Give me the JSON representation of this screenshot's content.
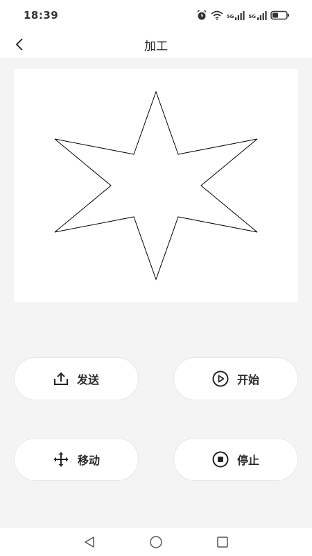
{
  "status_bar": {
    "time": "18:39",
    "network_1": "5G",
    "network_2": "5G",
    "icons": [
      "alarm-icon",
      "wifi-icon",
      "signal-icon",
      "signal-icon",
      "battery-icon"
    ]
  },
  "app_bar": {
    "title": "加工",
    "back_icon": "chevron-left-icon"
  },
  "canvas": {
    "shape": "six-pointed-star",
    "stroke_color": "#000000",
    "background": "#ffffff"
  },
  "actions": {
    "send": {
      "label": "发送",
      "icon": "upload-icon"
    },
    "start": {
      "label": "开始",
      "icon": "play-circle-icon"
    },
    "move": {
      "label": "移动",
      "icon": "move-arrows-icon"
    },
    "stop": {
      "label": "停止",
      "icon": "stop-circle-icon"
    }
  },
  "nav_bar": {
    "icons": [
      "back-triangle-icon",
      "home-circle-icon",
      "recents-square-icon"
    ]
  },
  "colors": {
    "background": "#f4f4f4",
    "surface": "#ffffff",
    "text": "#222222"
  }
}
